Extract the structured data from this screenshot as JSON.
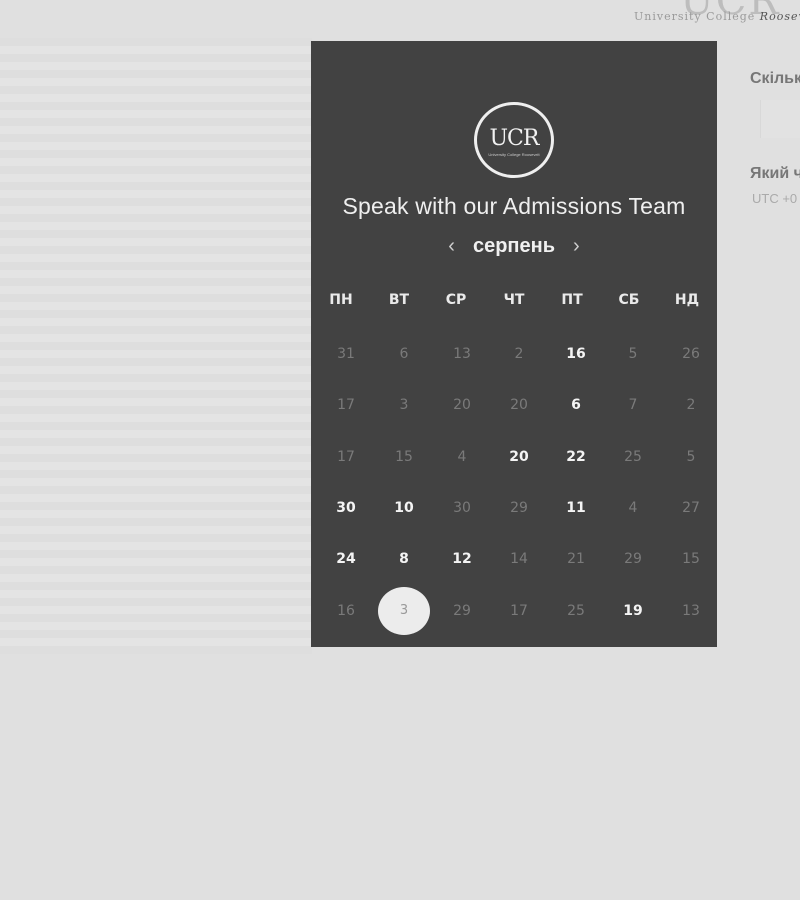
{
  "brand": {
    "top_logo_text": "UCR",
    "top_logo_sub": "University College",
    "top_logo_sub_italic": "Roosevelt",
    "badge_mark": "UCR",
    "badge_tag": "University College Roosevelt"
  },
  "calendar": {
    "title": "Speak with our Admissions Team",
    "month": "серпень",
    "prev_icon": "‹",
    "next_icon": "›",
    "weekdays": [
      "ПН",
      "ВТ",
      "СР",
      "ЧТ",
      "ПТ",
      "СБ",
      "НД"
    ],
    "rows": [
      [
        {
          "d": "31",
          "a": false
        },
        {
          "d": "6",
          "a": false
        },
        {
          "d": "13",
          "a": false
        },
        {
          "d": "2",
          "a": false
        },
        {
          "d": "16",
          "a": true
        },
        {
          "d": "5",
          "a": false
        },
        {
          "d": "26",
          "a": false
        }
      ],
      [
        {
          "d": "17",
          "a": false
        },
        {
          "d": "3",
          "a": false
        },
        {
          "d": "20",
          "a": false
        },
        {
          "d": "20",
          "a": false
        },
        {
          "d": "6",
          "a": true
        },
        {
          "d": "7",
          "a": false
        },
        {
          "d": "2",
          "a": false
        }
      ],
      [
        {
          "d": "17",
          "a": false
        },
        {
          "d": "15",
          "a": false
        },
        {
          "d": "4",
          "a": false
        },
        {
          "d": "20",
          "a": true
        },
        {
          "d": "22",
          "a": true
        },
        {
          "d": "25",
          "a": false
        },
        {
          "d": "5",
          "a": false
        }
      ],
      [
        {
          "d": "30",
          "a": true
        },
        {
          "d": "10",
          "a": true
        },
        {
          "d": "30",
          "a": false
        },
        {
          "d": "29",
          "a": false
        },
        {
          "d": "11",
          "a": true
        },
        {
          "d": "4",
          "a": false
        },
        {
          "d": "27",
          "a": false
        }
      ],
      [
        {
          "d": "24",
          "a": true
        },
        {
          "d": "8",
          "a": true
        },
        {
          "d": "12",
          "a": true
        },
        {
          "d": "14",
          "a": false
        },
        {
          "d": "21",
          "a": false
        },
        {
          "d": "29",
          "a": false
        },
        {
          "d": "15",
          "a": false
        }
      ],
      [
        {
          "d": "16",
          "a": false
        },
        {
          "d": "3",
          "a": false,
          "selected": true
        },
        {
          "d": "29",
          "a": false
        },
        {
          "d": "17",
          "a": false
        },
        {
          "d": "25",
          "a": false
        },
        {
          "d": "19",
          "a": true
        },
        {
          "d": "13",
          "a": false
        }
      ]
    ]
  },
  "side": {
    "question1": "Скільк",
    "question2": "Який ч",
    "timezone": "UTC +0"
  }
}
